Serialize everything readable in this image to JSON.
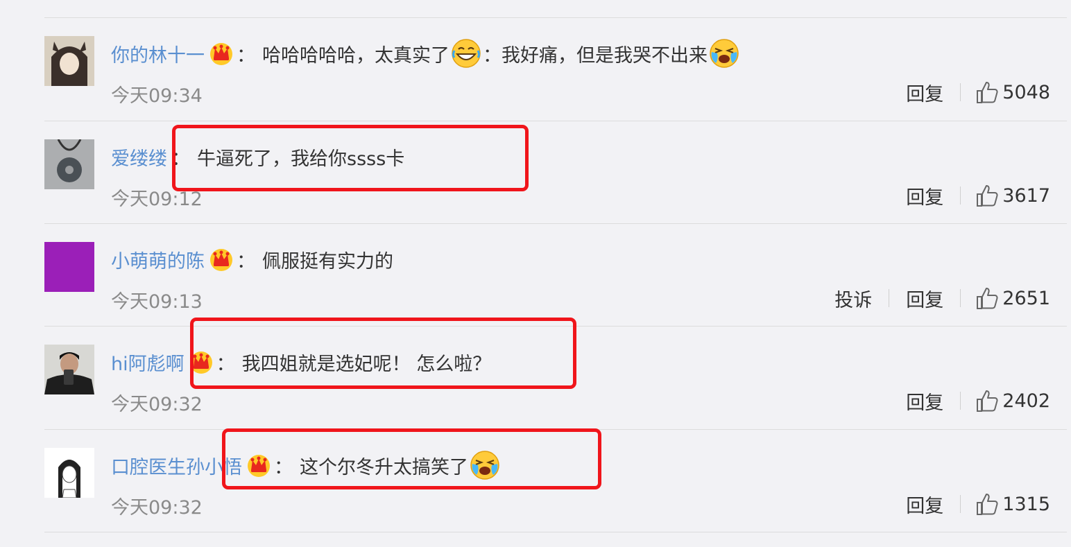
{
  "colors": {
    "username": "#5a8fd0",
    "text": "#333333",
    "time": "#8a8a8a",
    "highlight": "#f0151b",
    "background": "#f2f2f5"
  },
  "comments": [
    {
      "user": "你的林十一",
      "vip": true,
      "colon": "：",
      "text_parts": [
        "哈哈哈哈哈，太真实了",
        "：我好痛，但是我哭不出来"
      ],
      "emojis": [
        "laughing-tears-emoji",
        "crying-laugh-emoji"
      ],
      "time": "今天09:34",
      "reply": "回复",
      "likes": "5048",
      "avatar_icon": "anime-girl-avatar"
    },
    {
      "user": "爱缕缕",
      "vip": false,
      "colon": "：",
      "text_parts": [
        "牛逼死了，我给你ssss卡"
      ],
      "time": "今天09:12",
      "reply": "回复",
      "likes": "3617",
      "avatar_icon": "pendant-avatar"
    },
    {
      "user": "小萌萌的陈",
      "vip": true,
      "colon": "：",
      "text_parts": [
        "佩服挺有实力的"
      ],
      "time": "今天09:13",
      "report": "投诉",
      "reply": "回复",
      "likes": "2651",
      "avatar_icon": "purple-square-avatar"
    },
    {
      "user": "hi阿彪啊",
      "vip": true,
      "colon": "：",
      "text_parts": [
        "我四姐就是选妃呢！ 怎么啦？"
      ],
      "time": "今天09:32",
      "reply": "回复",
      "likes": "2402",
      "avatar_icon": "selfie-man-avatar"
    },
    {
      "user": "口腔医生孙小悟",
      "vip": true,
      "colon": "：",
      "text_parts": [
        "这个尔冬升太搞笑了"
      ],
      "emojis": [
        "crying-laugh-emoji"
      ],
      "time": "今天09:32",
      "reply": "回复",
      "likes": "1315",
      "avatar_icon": "sketch-girl-avatar"
    }
  ]
}
